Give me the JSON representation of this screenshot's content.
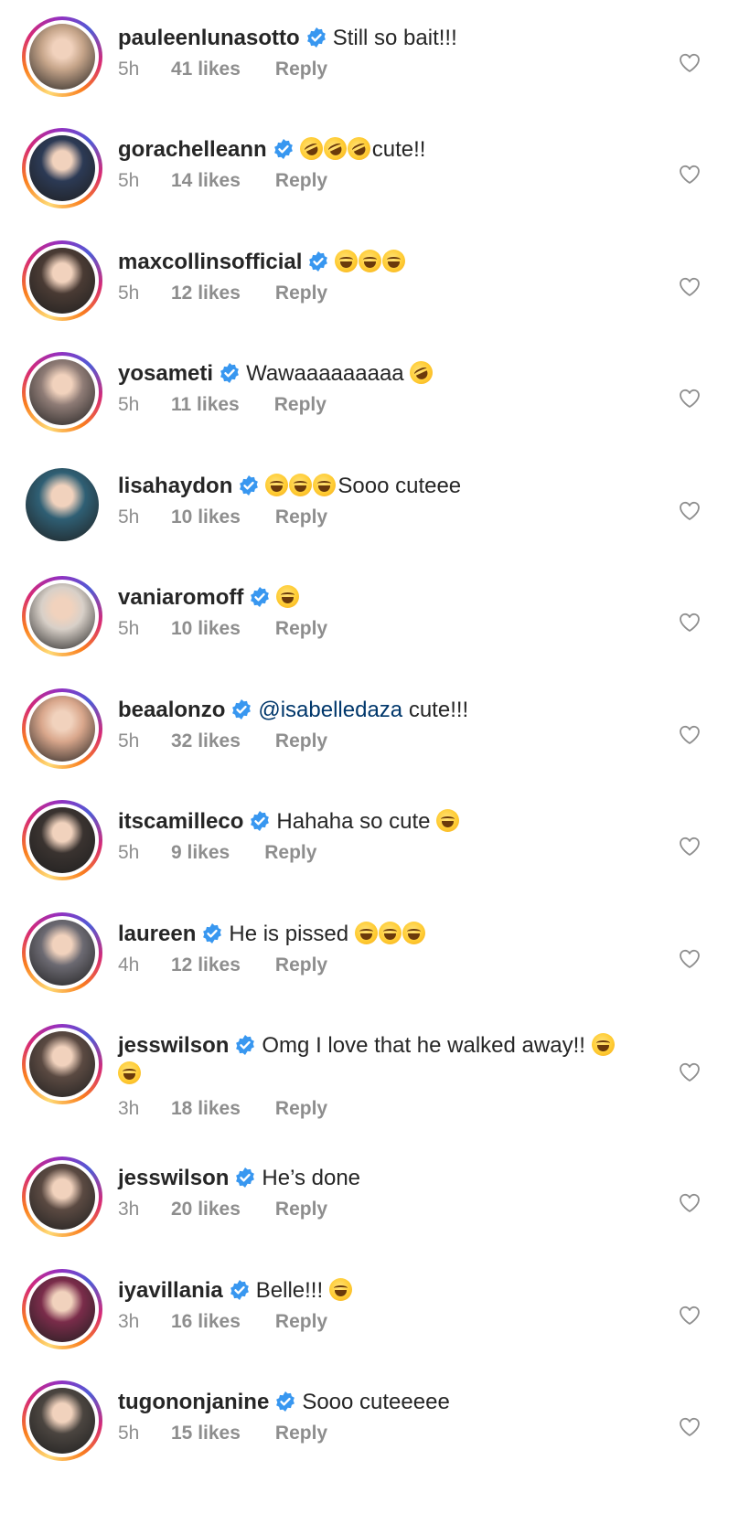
{
  "comments": [
    {
      "user": "pauleenlunasotto",
      "text": "Still so bait!!!",
      "emoji_before": 0,
      "emoji_after": 0,
      "time": "5h",
      "likes": "41 likes",
      "reply": "Reply",
      "ring": true,
      "avatar_color": "#c6a58a"
    },
    {
      "user": "gorachelleann",
      "text": "cute!!",
      "emoji_before": 3,
      "emoji_kind": "rofl",
      "emoji_after": 0,
      "time": "5h",
      "likes": "14 likes",
      "reply": "Reply",
      "ring": true,
      "avatar_color": "#2c3a55"
    },
    {
      "user": "maxcollinsofficial",
      "text": "",
      "emoji_before": 0,
      "emoji_after": 3,
      "time": "5h",
      "likes": "12 likes",
      "reply": "Reply",
      "ring": true,
      "avatar_color": "#4a3b34"
    },
    {
      "user": "yosameti",
      "text": "Wawaaaaaaaaa",
      "emoji_before": 0,
      "emoji_after": 1,
      "emoji_kind": "rofl",
      "time": "5h",
      "likes": "11 likes",
      "reply": "Reply",
      "ring": true,
      "avatar_color": "#8f7c76"
    },
    {
      "user": "lisahaydon",
      "text": "Sooo cuteee",
      "emoji_before": 3,
      "emoji_after": 0,
      "time": "5h",
      "likes": "10 likes",
      "reply": "Reply",
      "ring": false,
      "avatar_color": "#2f5f74"
    },
    {
      "user": "vaniaromoff",
      "text": "",
      "emoji_before": 0,
      "emoji_after": 1,
      "time": "5h",
      "likes": "10 likes",
      "reply": "Reply",
      "ring": true,
      "avatar_color": "#d8d0c8"
    },
    {
      "user": "beaalonzo",
      "mention": "@isabelledaza",
      "text": "cute!!!",
      "emoji_before": 0,
      "emoji_after": 0,
      "time": "5h",
      "likes": "32 likes",
      "reply": "Reply",
      "ring": true,
      "avatar_color": "#d9a78c"
    },
    {
      "user": "itscamilleco",
      "text": "Hahaha so cute",
      "emoji_before": 0,
      "emoji_after": 1,
      "time": "5h",
      "likes": "9 likes",
      "reply": "Reply",
      "ring": true,
      "avatar_color": "#3a3330"
    },
    {
      "user": "laureen",
      "text": "He is pissed",
      "emoji_before": 0,
      "emoji_after": 3,
      "time": "4h",
      "likes": "12 likes",
      "reply": "Reply",
      "ring": true,
      "avatar_color": "#6c6a72"
    },
    {
      "user": "jesswilson",
      "text": "Omg I love that he walked away!!",
      "emoji_before": 0,
      "emoji_after": 1,
      "emoji_wrap": 1,
      "time": "3h",
      "likes": "18 likes",
      "reply": "Reply",
      "ring": true,
      "avatar_color": "#5b4a42"
    },
    {
      "user": "jesswilson",
      "text": "He’s done",
      "emoji_before": 0,
      "emoji_after": 0,
      "time": "3h",
      "likes": "20 likes",
      "reply": "Reply",
      "ring": true,
      "avatar_color": "#5b4a42"
    },
    {
      "user": "iyavillania",
      "text": "Belle!!!",
      "emoji_before": 0,
      "emoji_after": 1,
      "time": "3h",
      "likes": "16 likes",
      "reply": "Reply",
      "ring": true,
      "avatar_color": "#7a2c4a"
    },
    {
      "user": "tugononjanine",
      "text": "Sooo cuteeeee",
      "emoji_before": 0,
      "emoji_after": 0,
      "time": "5h",
      "likes": "15 likes",
      "reply": "Reply",
      "ring": true,
      "avatar_color": "#4b4540"
    }
  ],
  "colors": {
    "verified": "#3897f0",
    "muted": "#8e8e8e",
    "text": "#262626",
    "mention": "#00376b"
  },
  "icons": {
    "verified": "verified-badge-icon",
    "like": "heart-outline-icon",
    "emoji": "laughing-emoji-icon"
  }
}
